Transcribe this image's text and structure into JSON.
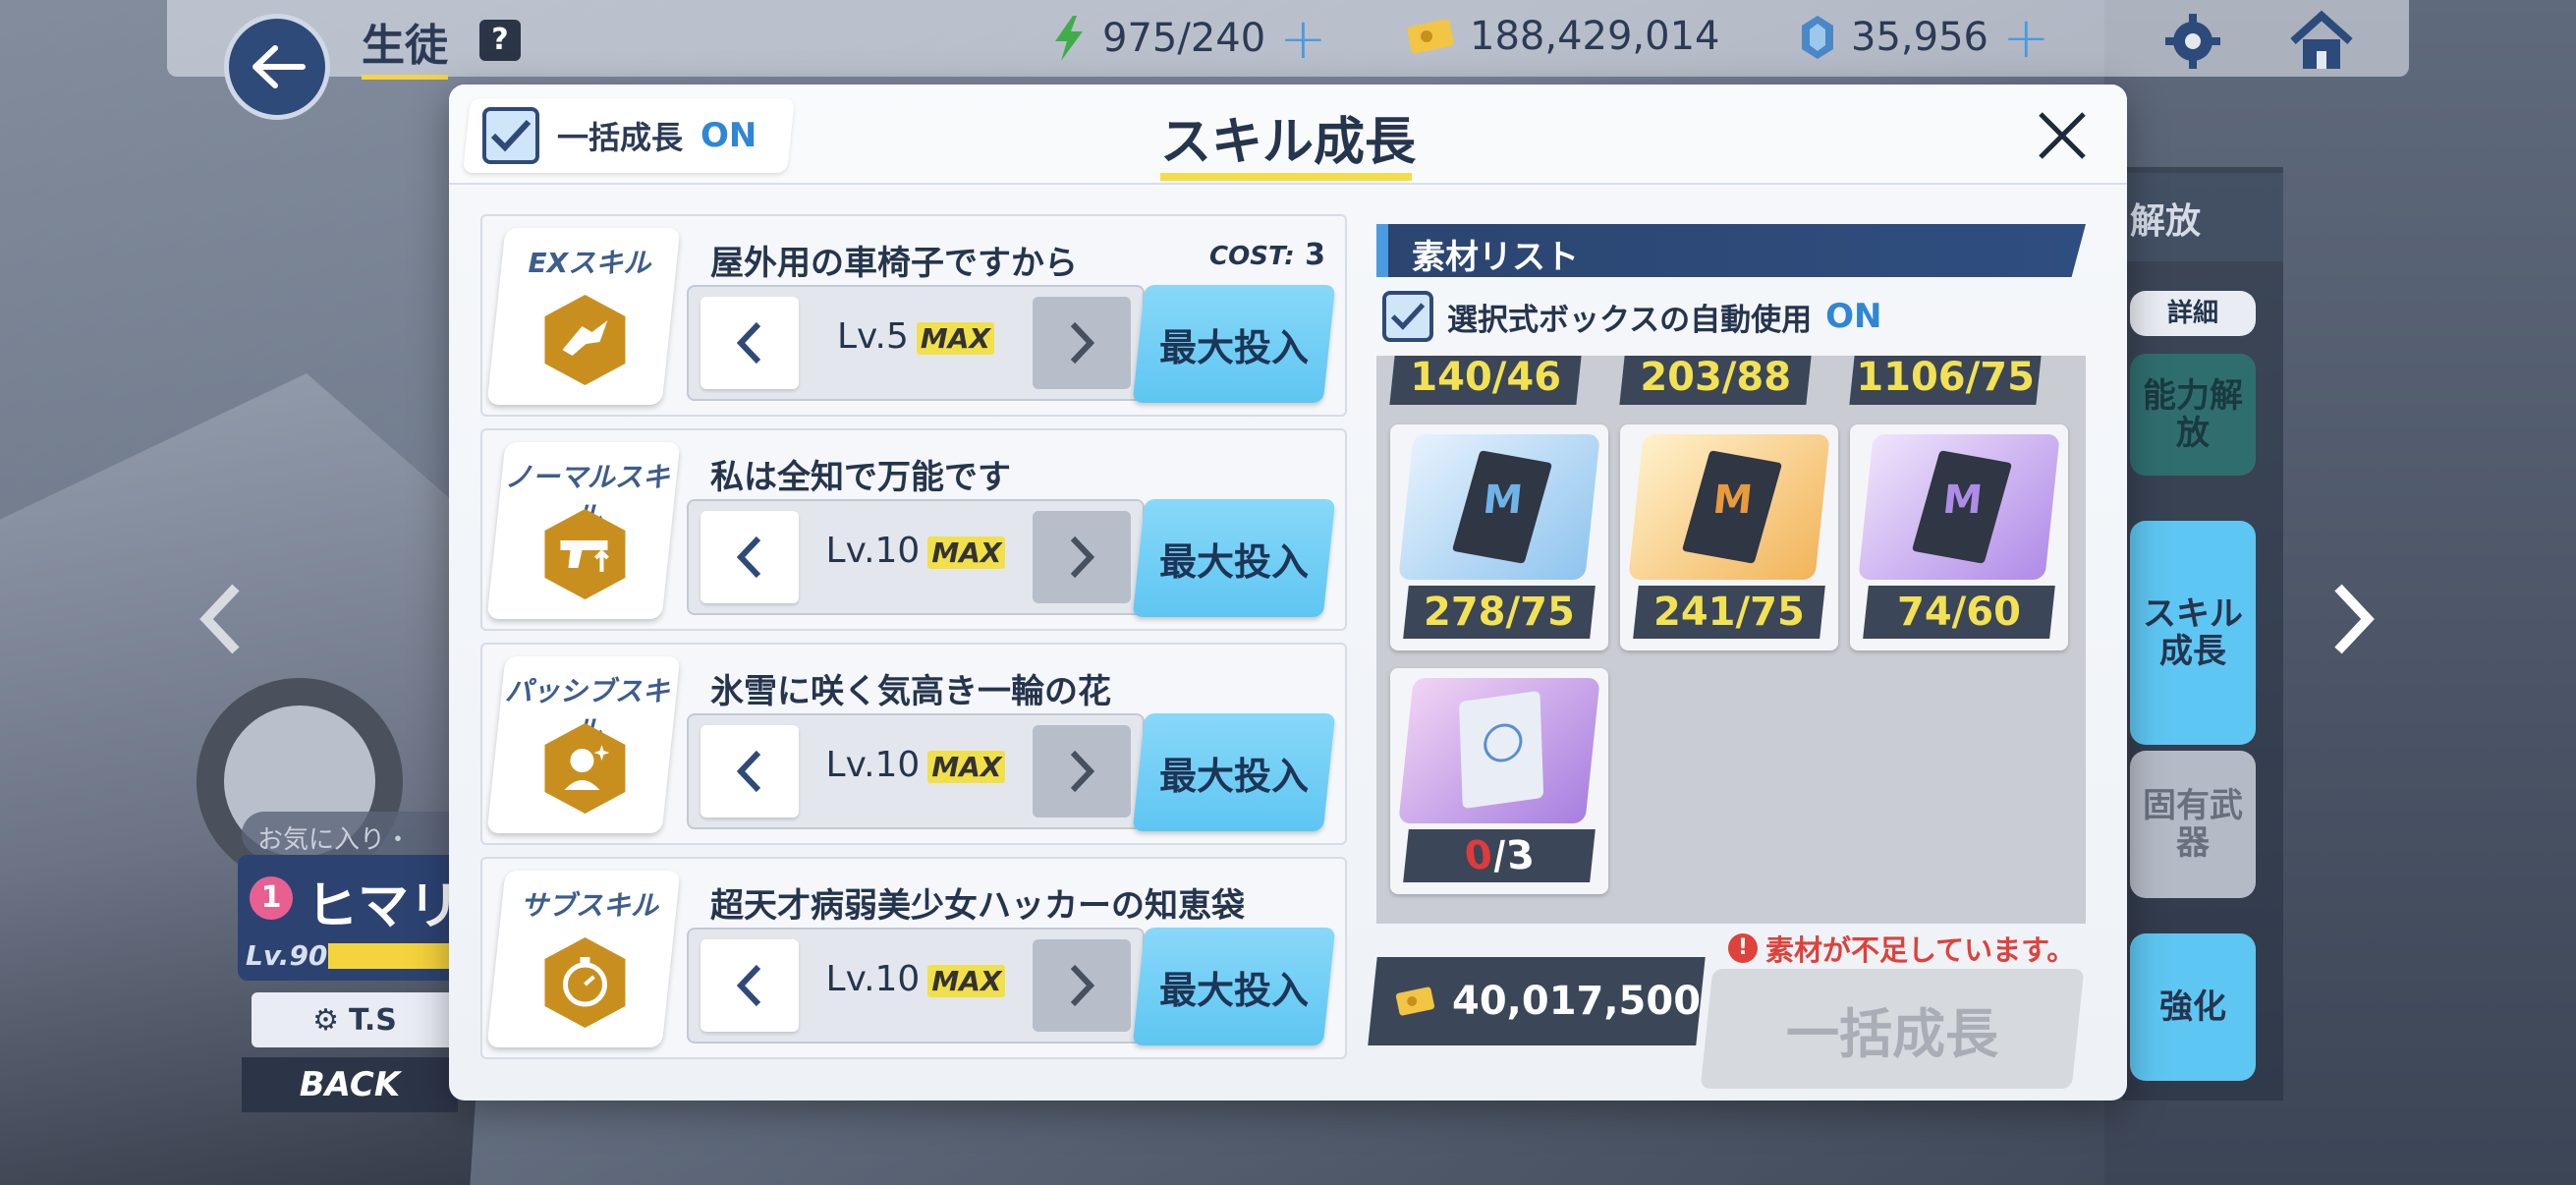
{
  "topbar": {
    "title": "生徒",
    "help": "?",
    "ap": "975/240",
    "credits": "188,429,014",
    "gems": "35,956"
  },
  "background": {
    "side_header": "解放",
    "detail_label": "詳細",
    "ability_unlock": "能力解放",
    "skill_growth": "スキル成長",
    "unique_weapon": "固有武器",
    "enhance": "強化",
    "fav_label": "お気に入り・",
    "student_name": "ヒマリ",
    "student_heart": "1",
    "student_level": "Lv.90",
    "ts_label": "T.S",
    "back_label": "BACK"
  },
  "modal": {
    "bulk_label": "一括成長",
    "bulk_state": "ON",
    "title": "スキル成長",
    "skills": [
      {
        "type": "EXスキル",
        "name": "屋外用の車椅子ですから",
        "cost_label": "COST:",
        "cost": "3",
        "level": "Lv.5",
        "max": "MAX",
        "button": "最大投入"
      },
      {
        "type": "ノーマルスキル",
        "name": "私は全知で万能です",
        "level": "Lv.10",
        "max": "MAX",
        "button": "最大投入"
      },
      {
        "type": "パッシブスキル",
        "name": "氷雪に咲く気高き一輪の花",
        "level": "Lv.10",
        "max": "MAX",
        "button": "最大投入"
      },
      {
        "type": "サブスキル",
        "name": "超天才病弱美少女ハッカーの知恵袋",
        "level": "Lv.10",
        "max": "MAX",
        "button": "最大投入"
      }
    ],
    "materials": {
      "header": "素材リスト",
      "auto_label": "選択式ボックスの自動使用",
      "auto_state": "ON",
      "partial_counts": [
        "140/46",
        "203/88",
        "1106/75"
      ],
      "items": [
        {
          "count": "278/75",
          "color": "#8fc4ee"
        },
        {
          "count": "241/75",
          "color": "#f2b45a"
        },
        {
          "count": "74/60",
          "color": "#b08be8"
        }
      ],
      "last_item": {
        "have": "0",
        "need": "/3"
      }
    },
    "credit_cost": "40,017,500",
    "warning": "素材が不足しています。",
    "bulk_button": "一括成長"
  }
}
